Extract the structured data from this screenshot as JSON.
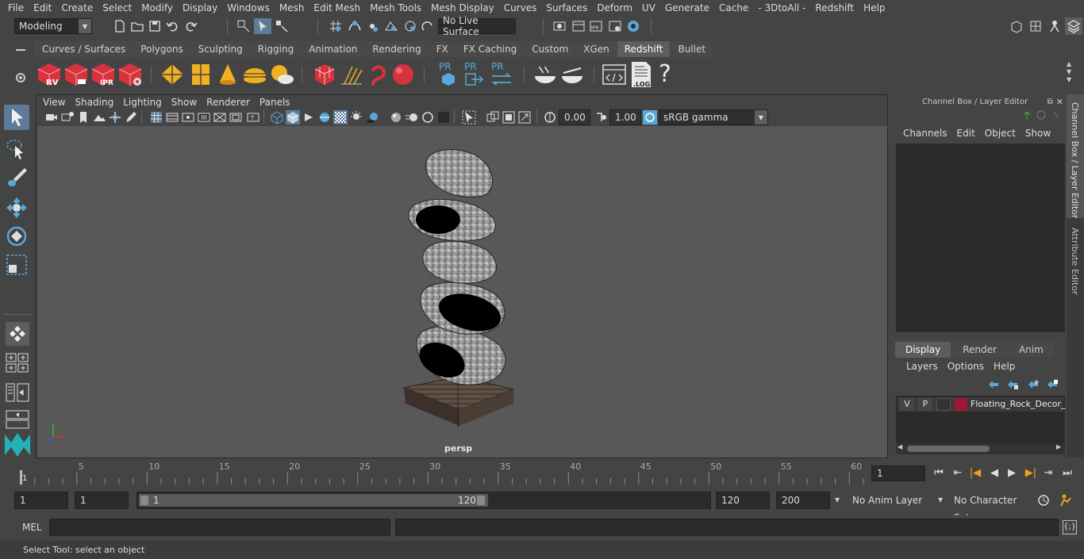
{
  "menubar": [
    "File",
    "Edit",
    "Create",
    "Select",
    "Modify",
    "Display",
    "Windows",
    "Mesh",
    "Edit Mesh",
    "Mesh Tools",
    "Mesh Display",
    "Curves",
    "Surfaces",
    "Deform",
    "UV",
    "Generate",
    "Cache",
    "- 3DtoAll -",
    "Redshift",
    "Help"
  ],
  "statusline": {
    "mode": "Modeling",
    "live_surface": "No Live Surface"
  },
  "shelf_tabs": [
    {
      "label": "Curves / Surfaces"
    },
    {
      "label": "Polygons"
    },
    {
      "label": "Sculpting"
    },
    {
      "label": "Rigging"
    },
    {
      "label": "Animation"
    },
    {
      "label": "Rendering"
    },
    {
      "label": "FX"
    },
    {
      "label": "FX Caching"
    },
    {
      "label": "Custom"
    },
    {
      "label": "XGen"
    },
    {
      "label": "Redshift",
      "active": true
    },
    {
      "label": "Bullet"
    }
  ],
  "shelf_icons": {
    "rv": "RV",
    "ipr": "IPR",
    "pr": "PR",
    "log": ".LOG",
    "help": "?"
  },
  "viewport": {
    "menus": [
      "View",
      "Shading",
      "Lighting",
      "Show",
      "Renderer",
      "Panels"
    ],
    "exposure": "0.00",
    "gamma": "1.00",
    "color_space": "sRGB gamma",
    "camera_label": "persp"
  },
  "channel_box": {
    "title": "Channel Box / Layer Editor",
    "menus": [
      "Channels",
      "Edit",
      "Object",
      "Show"
    ]
  },
  "layer_editor": {
    "tabs": [
      "Display",
      "Render",
      "Anim"
    ],
    "active_tab": "Display",
    "menus": [
      "Layers",
      "Options",
      "Help"
    ],
    "layer": {
      "v": "V",
      "p": "P",
      "name": "Floating_Rock_Decor_",
      "color": "#a01535"
    }
  },
  "side_tabs": [
    "Channel Box / Layer Editor",
    "Attribute Editor"
  ],
  "timeline": {
    "ticks": [
      "5",
      "10",
      "15",
      "20",
      "25",
      "30",
      "35",
      "40",
      "45",
      "50",
      "55",
      "60",
      "65",
      "70",
      "75",
      "80",
      "85",
      "90",
      "95",
      "100",
      "105",
      "110",
      "115",
      "12"
    ],
    "start_tick": "1",
    "current_frame": "1"
  },
  "range": {
    "start": "1",
    "playback_start": "1",
    "slider_start": "1",
    "slider_end": "120",
    "playback_end": "120",
    "end": "200",
    "anim_layer": "No Anim Layer",
    "character_set": "No Character Set"
  },
  "command": {
    "lang": "MEL"
  },
  "help_line": "Select Tool: select an object",
  "colors": {
    "redshift_red": "#d8323c",
    "accent_blue": "#5aa8d8",
    "active_tool": "#5d7b99",
    "yellow": "#f0b020"
  }
}
